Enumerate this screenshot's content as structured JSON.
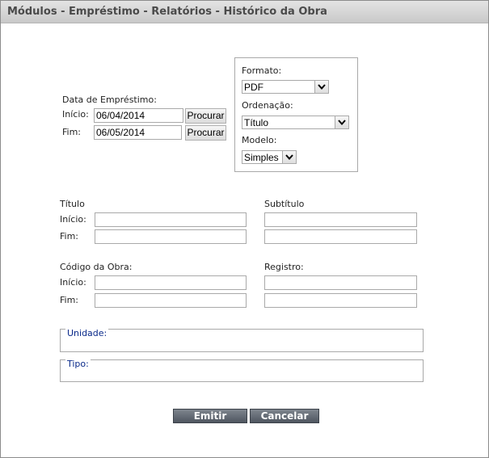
{
  "window": {
    "title": "Módulos - Empréstimo - Relatórios - Histórico da Obra"
  },
  "loan_date": {
    "label": "Data de Empréstimo:",
    "start_label": "Início:",
    "start_value": "06/04/2014",
    "end_label": "Fim:",
    "end_value": "06/05/2014",
    "search_label": "Procurar"
  },
  "options": {
    "format_label": "Formato:",
    "format_value": "PDF",
    "order_label": "Ordenação:",
    "order_value": "Título",
    "model_label": "Modelo:",
    "model_value": "Simples"
  },
  "title_filter": {
    "label": "Título",
    "start_label": "Início:",
    "end_label": "Fim:",
    "start_value": "",
    "end_value": ""
  },
  "subtitle_filter": {
    "label": "Subtítulo",
    "start_value": "",
    "end_value": ""
  },
  "work_code_filter": {
    "label": "Código da Obra:",
    "start_label": "Início:",
    "end_label": "Fim:",
    "start_value": "",
    "end_value": ""
  },
  "record_filter": {
    "label": "Registro:",
    "start_value": "",
    "end_value": ""
  },
  "unit_group": {
    "legend": "Unidade:"
  },
  "type_group": {
    "legend": "Tipo:"
  },
  "actions": {
    "emit_label": "Emitir",
    "cancel_label": "Cancelar"
  }
}
